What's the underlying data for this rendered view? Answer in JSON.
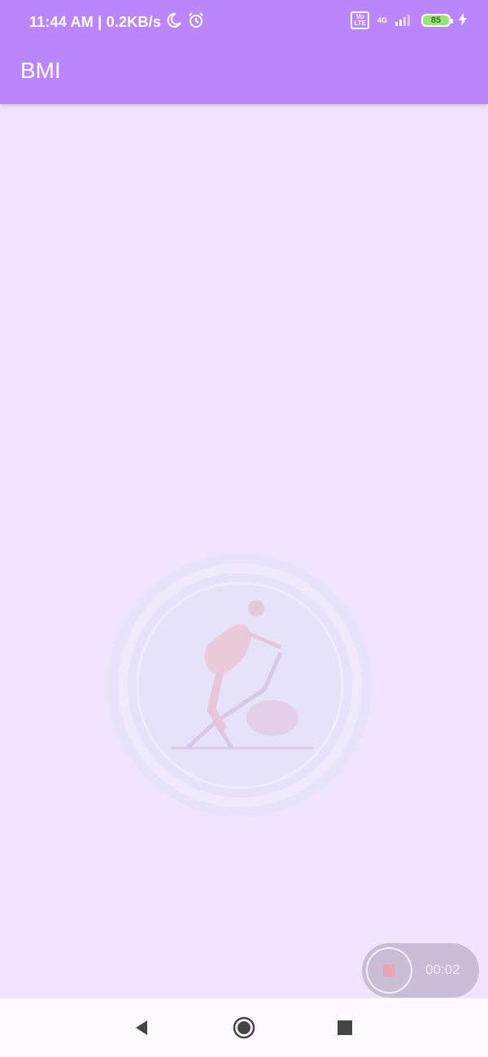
{
  "status_bar": {
    "time_speed": "11:44 AM | 0.2KB/s",
    "volte": "Vo\nLTE",
    "network": "4G",
    "battery_level": "85"
  },
  "app_bar": {
    "title": "BMI"
  },
  "recorder": {
    "elapsed": "00:02"
  },
  "icons": {
    "moon": "moon-icon",
    "alarm": "alarm-icon",
    "signal": "signal-icon",
    "charging": "charging-icon",
    "back": "back-icon",
    "home": "home-icon",
    "recents": "recents-icon"
  },
  "colors": {
    "primary": "#bb86fc",
    "background": "#f0e3fc",
    "nav_background": "#fdfafe"
  }
}
